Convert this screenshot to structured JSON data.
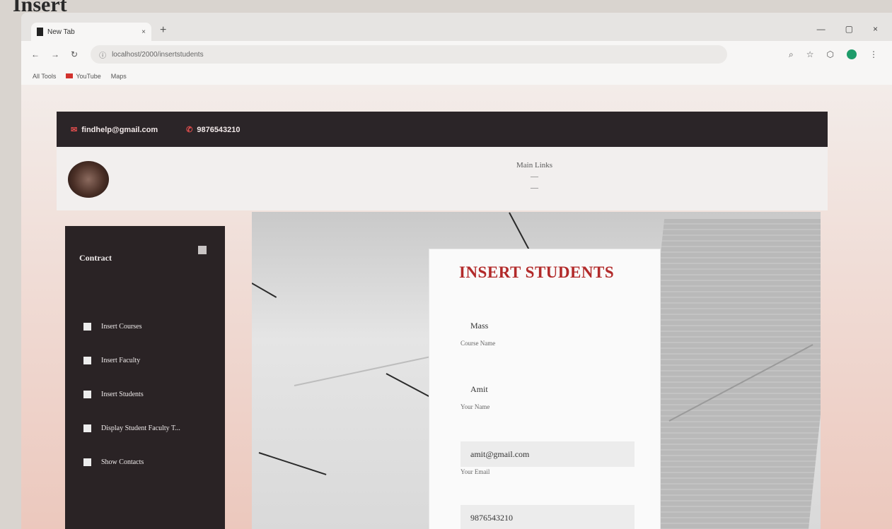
{
  "photo_caption": "Insert",
  "browser": {
    "tab_title": "New Tab",
    "tab_close": "×",
    "new_tab": "+",
    "window_controls": [
      "—",
      "▢",
      "×"
    ],
    "nav": [
      "←",
      "→",
      "↻"
    ],
    "url": "localhost/2000/insertstudents",
    "bookmarks": [
      "All Tools",
      "YouTube",
      "Maps"
    ]
  },
  "site": {
    "email": "findhelp@gmail.com",
    "phone": "9876543210",
    "nav_links": [
      "Main Links",
      "—",
      "—"
    ]
  },
  "sidebar": {
    "title": "Contract",
    "items": [
      "Insert Courses",
      "Insert Faculty",
      "Insert Students",
      "Display Student Faculty T...",
      "Show Contacts"
    ]
  },
  "form": {
    "title": "INSERT STUDENTS",
    "fields": [
      {
        "value": "Mass",
        "label": "Course Name"
      },
      {
        "value": "Amit",
        "label": "Your Name"
      },
      {
        "value": "amit@gmail.com",
        "label": "Your Email"
      },
      {
        "value": "9876543210",
        "label": ""
      }
    ]
  },
  "colors": {
    "topbar": "#2b2528",
    "sidebar": "#2a2325",
    "title_red": "#b22a2a",
    "page_gradient_end": "#ecc8bd"
  }
}
